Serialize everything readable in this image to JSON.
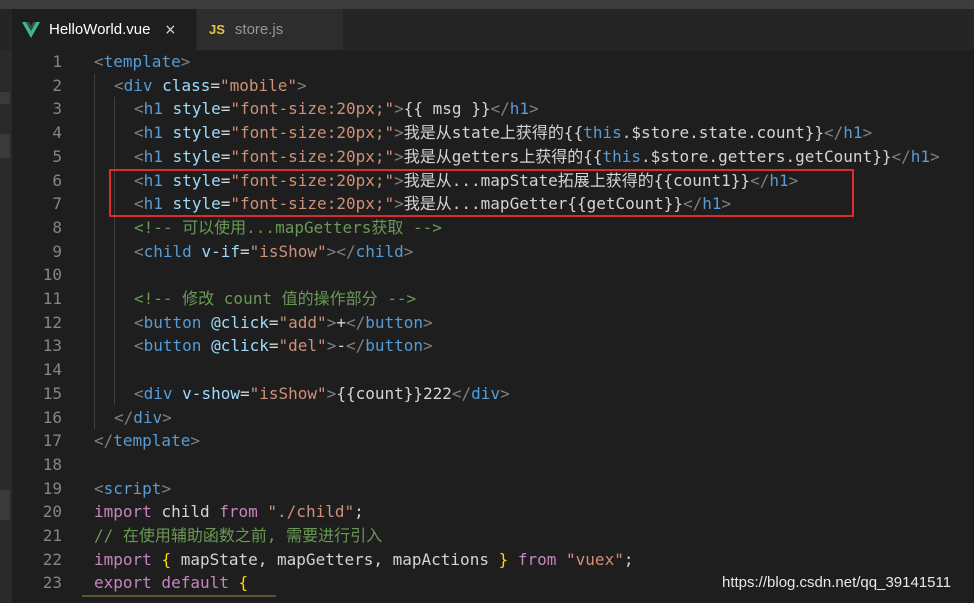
{
  "tabs": [
    {
      "label": "HelloWorld.vue",
      "icon": "vue-icon",
      "close": "×"
    },
    {
      "label": "store.js",
      "icon_text": "JS"
    }
  ],
  "lines": [
    {
      "n": "1"
    },
    {
      "n": "2"
    },
    {
      "n": "3"
    },
    {
      "n": "4"
    },
    {
      "n": "5"
    },
    {
      "n": "6"
    },
    {
      "n": "7"
    },
    {
      "n": "8"
    },
    {
      "n": "9"
    },
    {
      "n": "10"
    },
    {
      "n": "11"
    },
    {
      "n": "12"
    },
    {
      "n": "13"
    },
    {
      "n": "14"
    },
    {
      "n": "15"
    },
    {
      "n": "16"
    },
    {
      "n": "17"
    },
    {
      "n": "18"
    },
    {
      "n": "19"
    },
    {
      "n": "20"
    },
    {
      "n": "21"
    },
    {
      "n": "22"
    },
    {
      "n": "23"
    }
  ],
  "code": {
    "l1": [
      [
        "p",
        "<"
      ],
      [
        "t",
        "template"
      ],
      [
        "p",
        ">"
      ]
    ],
    "l2": [
      [
        "p",
        "<"
      ],
      [
        "t",
        "div "
      ],
      [
        "a",
        "class"
      ],
      [
        "x",
        "="
      ],
      [
        "s",
        "\"mobile\""
      ],
      [
        "p",
        ">"
      ]
    ],
    "l3": [
      [
        "p",
        "<"
      ],
      [
        "t",
        "h1 "
      ],
      [
        "a",
        "style"
      ],
      [
        "x",
        "="
      ],
      [
        "s",
        "\"font-size:20px;\""
      ],
      [
        "p",
        ">"
      ],
      [
        "x",
        "{{ msg }}"
      ],
      [
        "p",
        "</"
      ],
      [
        "t",
        "h1"
      ],
      [
        "p",
        ">"
      ]
    ],
    "l4": [
      [
        "p",
        "<"
      ],
      [
        "t",
        "h1 "
      ],
      [
        "a",
        "style"
      ],
      [
        "x",
        "="
      ],
      [
        "s",
        "\"font-size:20px;\""
      ],
      [
        "p",
        ">"
      ],
      [
        "x",
        "我是从state上获得的{{"
      ],
      [
        "t",
        "this"
      ],
      [
        "x",
        ".$store.state.count}}"
      ],
      [
        "p",
        "</"
      ],
      [
        "t",
        "h1"
      ],
      [
        "p",
        ">"
      ]
    ],
    "l5": [
      [
        "p",
        "<"
      ],
      [
        "t",
        "h1 "
      ],
      [
        "a",
        "style"
      ],
      [
        "x",
        "="
      ],
      [
        "s",
        "\"font-size:20px;\""
      ],
      [
        "p",
        ">"
      ],
      [
        "x",
        "我是从getters上获得的{{"
      ],
      [
        "t",
        "this"
      ],
      [
        "x",
        ".$store.getters.getCount}}"
      ],
      [
        "p",
        "</"
      ],
      [
        "t",
        "h1"
      ],
      [
        "p",
        ">"
      ]
    ],
    "l6": [
      [
        "p",
        "<"
      ],
      [
        "t",
        "h1 "
      ],
      [
        "a",
        "style"
      ],
      [
        "x",
        "="
      ],
      [
        "s",
        "\"font-size:20px;\""
      ],
      [
        "p",
        ">"
      ],
      [
        "x",
        "我是从...mapState拓展上获得的{{count1}}"
      ],
      [
        "p",
        "</"
      ],
      [
        "t",
        "h1"
      ],
      [
        "p",
        ">"
      ]
    ],
    "l7": [
      [
        "p",
        "<"
      ],
      [
        "t",
        "h1 "
      ],
      [
        "a",
        "style"
      ],
      [
        "x",
        "="
      ],
      [
        "s",
        "\"font-size:20px;\""
      ],
      [
        "p",
        ">"
      ],
      [
        "x",
        "我是从...mapGetter{{getCount}}"
      ],
      [
        "p",
        "</"
      ],
      [
        "t",
        "h1"
      ],
      [
        "p",
        ">"
      ]
    ],
    "l8": [
      [
        "c",
        "<!-- 可以使用...mapGetters获取 -->"
      ]
    ],
    "l9": [
      [
        "p",
        "<"
      ],
      [
        "t",
        "child "
      ],
      [
        "a",
        "v-if"
      ],
      [
        "x",
        "="
      ],
      [
        "s",
        "\"isShow\""
      ],
      [
        "p",
        "></"
      ],
      [
        "t",
        "child"
      ],
      [
        "p",
        ">"
      ]
    ],
    "l10": [],
    "l11": [
      [
        "c",
        "<!-- 修改 count 值的操作部分 -->"
      ]
    ],
    "l12": [
      [
        "p",
        "<"
      ],
      [
        "t",
        "button "
      ],
      [
        "a",
        "@click"
      ],
      [
        "x",
        "="
      ],
      [
        "s",
        "\"add\""
      ],
      [
        "p",
        ">"
      ],
      [
        "x",
        "+"
      ],
      [
        "p",
        "</"
      ],
      [
        "t",
        "button"
      ],
      [
        "p",
        ">"
      ]
    ],
    "l13": [
      [
        "p",
        "<"
      ],
      [
        "t",
        "button "
      ],
      [
        "a",
        "@click"
      ],
      [
        "x",
        "="
      ],
      [
        "s",
        "\"del\""
      ],
      [
        "p",
        ">"
      ],
      [
        "x",
        "-"
      ],
      [
        "p",
        "</"
      ],
      [
        "t",
        "button"
      ],
      [
        "p",
        ">"
      ]
    ],
    "l14": [],
    "l15": [
      [
        "p",
        "<"
      ],
      [
        "t",
        "div "
      ],
      [
        "a",
        "v-show"
      ],
      [
        "x",
        "="
      ],
      [
        "s",
        "\"isShow\""
      ],
      [
        "p",
        ">"
      ],
      [
        "x",
        "{{count}}222"
      ],
      [
        "p",
        "</"
      ],
      [
        "t",
        "div"
      ],
      [
        "p",
        ">"
      ]
    ],
    "l16": [
      [
        "p",
        "</"
      ],
      [
        "t",
        "div"
      ],
      [
        "p",
        ">"
      ]
    ],
    "l17": [
      [
        "p",
        "</"
      ],
      [
        "t",
        "template"
      ],
      [
        "p",
        ">"
      ]
    ],
    "l18": [],
    "l19": [
      [
        "p",
        "<"
      ],
      [
        "t",
        "script"
      ],
      [
        "p",
        ">"
      ]
    ],
    "l20": [
      [
        "k",
        "import "
      ],
      [
        "x",
        "child "
      ],
      [
        "k",
        "from "
      ],
      [
        "s",
        "\"./child\""
      ],
      [
        "x",
        ";"
      ]
    ],
    "l21": [
      [
        "c",
        "// 在使用辅助函数之前, 需要进行引入"
      ]
    ],
    "l22": [
      [
        "k",
        "import "
      ],
      [
        "b",
        "{ "
      ],
      [
        "x",
        "mapState, mapGetters, mapActions "
      ],
      [
        "b",
        "}"
      ],
      [
        "k",
        " from "
      ],
      [
        "s",
        "\"vuex\""
      ],
      [
        "x",
        ";"
      ]
    ],
    "l23": [
      [
        "k",
        "export default "
      ],
      [
        "b",
        "{"
      ]
    ]
  },
  "watermark": "https://blog.csdn.net/qq_39141511",
  "colors": {
    "highlight_box": "#e0292f",
    "vue_green": "#41b883",
    "js_yellow": "#e8c343"
  }
}
